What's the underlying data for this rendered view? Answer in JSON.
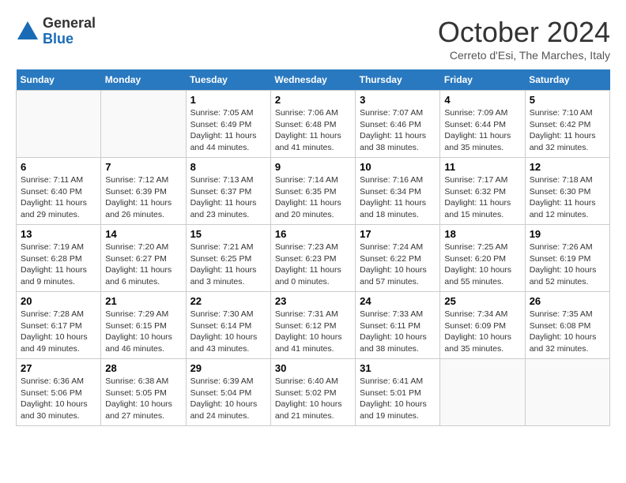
{
  "logo": {
    "general": "General",
    "blue": "Blue"
  },
  "title": "October 2024",
  "subtitle": "Cerreto d'Esi, The Marches, Italy",
  "days_header": [
    "Sunday",
    "Monday",
    "Tuesday",
    "Wednesday",
    "Thursday",
    "Friday",
    "Saturday"
  ],
  "weeks": [
    [
      {
        "day": "",
        "info": ""
      },
      {
        "day": "",
        "info": ""
      },
      {
        "day": "1",
        "info": "Sunrise: 7:05 AM\nSunset: 6:49 PM\nDaylight: 11 hours and 44 minutes."
      },
      {
        "day": "2",
        "info": "Sunrise: 7:06 AM\nSunset: 6:48 PM\nDaylight: 11 hours and 41 minutes."
      },
      {
        "day": "3",
        "info": "Sunrise: 7:07 AM\nSunset: 6:46 PM\nDaylight: 11 hours and 38 minutes."
      },
      {
        "day": "4",
        "info": "Sunrise: 7:09 AM\nSunset: 6:44 PM\nDaylight: 11 hours and 35 minutes."
      },
      {
        "day": "5",
        "info": "Sunrise: 7:10 AM\nSunset: 6:42 PM\nDaylight: 11 hours and 32 minutes."
      }
    ],
    [
      {
        "day": "6",
        "info": "Sunrise: 7:11 AM\nSunset: 6:40 PM\nDaylight: 11 hours and 29 minutes."
      },
      {
        "day": "7",
        "info": "Sunrise: 7:12 AM\nSunset: 6:39 PM\nDaylight: 11 hours and 26 minutes."
      },
      {
        "day": "8",
        "info": "Sunrise: 7:13 AM\nSunset: 6:37 PM\nDaylight: 11 hours and 23 minutes."
      },
      {
        "day": "9",
        "info": "Sunrise: 7:14 AM\nSunset: 6:35 PM\nDaylight: 11 hours and 20 minutes."
      },
      {
        "day": "10",
        "info": "Sunrise: 7:16 AM\nSunset: 6:34 PM\nDaylight: 11 hours and 18 minutes."
      },
      {
        "day": "11",
        "info": "Sunrise: 7:17 AM\nSunset: 6:32 PM\nDaylight: 11 hours and 15 minutes."
      },
      {
        "day": "12",
        "info": "Sunrise: 7:18 AM\nSunset: 6:30 PM\nDaylight: 11 hours and 12 minutes."
      }
    ],
    [
      {
        "day": "13",
        "info": "Sunrise: 7:19 AM\nSunset: 6:28 PM\nDaylight: 11 hours and 9 minutes."
      },
      {
        "day": "14",
        "info": "Sunrise: 7:20 AM\nSunset: 6:27 PM\nDaylight: 11 hours and 6 minutes."
      },
      {
        "day": "15",
        "info": "Sunrise: 7:21 AM\nSunset: 6:25 PM\nDaylight: 11 hours and 3 minutes."
      },
      {
        "day": "16",
        "info": "Sunrise: 7:23 AM\nSunset: 6:23 PM\nDaylight: 11 hours and 0 minutes."
      },
      {
        "day": "17",
        "info": "Sunrise: 7:24 AM\nSunset: 6:22 PM\nDaylight: 10 hours and 57 minutes."
      },
      {
        "day": "18",
        "info": "Sunrise: 7:25 AM\nSunset: 6:20 PM\nDaylight: 10 hours and 55 minutes."
      },
      {
        "day": "19",
        "info": "Sunrise: 7:26 AM\nSunset: 6:19 PM\nDaylight: 10 hours and 52 minutes."
      }
    ],
    [
      {
        "day": "20",
        "info": "Sunrise: 7:28 AM\nSunset: 6:17 PM\nDaylight: 10 hours and 49 minutes."
      },
      {
        "day": "21",
        "info": "Sunrise: 7:29 AM\nSunset: 6:15 PM\nDaylight: 10 hours and 46 minutes."
      },
      {
        "day": "22",
        "info": "Sunrise: 7:30 AM\nSunset: 6:14 PM\nDaylight: 10 hours and 43 minutes."
      },
      {
        "day": "23",
        "info": "Sunrise: 7:31 AM\nSunset: 6:12 PM\nDaylight: 10 hours and 41 minutes."
      },
      {
        "day": "24",
        "info": "Sunrise: 7:33 AM\nSunset: 6:11 PM\nDaylight: 10 hours and 38 minutes."
      },
      {
        "day": "25",
        "info": "Sunrise: 7:34 AM\nSunset: 6:09 PM\nDaylight: 10 hours and 35 minutes."
      },
      {
        "day": "26",
        "info": "Sunrise: 7:35 AM\nSunset: 6:08 PM\nDaylight: 10 hours and 32 minutes."
      }
    ],
    [
      {
        "day": "27",
        "info": "Sunrise: 6:36 AM\nSunset: 5:06 PM\nDaylight: 10 hours and 30 minutes."
      },
      {
        "day": "28",
        "info": "Sunrise: 6:38 AM\nSunset: 5:05 PM\nDaylight: 10 hours and 27 minutes."
      },
      {
        "day": "29",
        "info": "Sunrise: 6:39 AM\nSunset: 5:04 PM\nDaylight: 10 hours and 24 minutes."
      },
      {
        "day": "30",
        "info": "Sunrise: 6:40 AM\nSunset: 5:02 PM\nDaylight: 10 hours and 21 minutes."
      },
      {
        "day": "31",
        "info": "Sunrise: 6:41 AM\nSunset: 5:01 PM\nDaylight: 10 hours and 19 minutes."
      },
      {
        "day": "",
        "info": ""
      },
      {
        "day": "",
        "info": ""
      }
    ]
  ]
}
